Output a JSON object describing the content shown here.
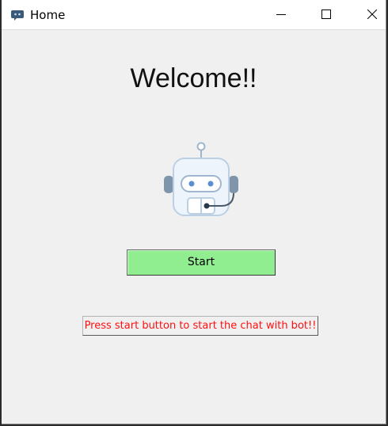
{
  "window": {
    "title": "Home",
    "app_icon": "robot-chat-icon",
    "controls": {
      "minimize": "minimize-icon",
      "maximize": "maximize-icon",
      "close": "close-icon"
    }
  },
  "main": {
    "heading": "Welcome!!",
    "image": "robot-headset-icon",
    "start_button": {
      "label": "Start",
      "color": "#90ee90"
    },
    "hint": {
      "text": "Press start button to start the chat with bot!!",
      "color": "#ff1010"
    }
  }
}
